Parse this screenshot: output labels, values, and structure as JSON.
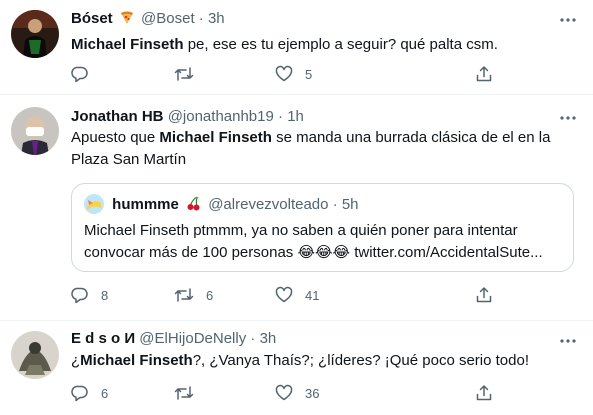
{
  "tweets": [
    {
      "name": "Bóset",
      "name_emoji_icon": "pizza-icon",
      "handle": "@Boset",
      "time": "3h",
      "text_highlight": "Michael Finseth",
      "text_rest": " pe, ese es tu ejemplo a seguir? qué palta csm.",
      "replies": "",
      "retweets": "",
      "likes": "5"
    },
    {
      "name": "Jonathan HB",
      "handle": "@jonathanhb19",
      "time": "1h",
      "text_pre": "Apuesto que ",
      "text_highlight": "Michael Finseth",
      "text_rest": " se manda una burrada clásica de el en la Plaza San Martín",
      "quote": {
        "name": "hummme",
        "name_emoji_icon": "cherries-icon",
        "handle": "@alrevezvolteado",
        "time": "5h",
        "text": "Michael Finseth ptmmm, ya no saben a quién poner para intentar convocar más de 100 personas 😂😂😂 twitter.com/AccidentalSute..."
      },
      "replies": "8",
      "retweets": "6",
      "likes": "41"
    },
    {
      "name": "E d s o И",
      "handle": "@ElHijoDeNelly",
      "time": "3h",
      "text_pre": "¿",
      "text_highlight": "Michael Finseth",
      "text_rest": "?, ¿Vanya Thaís?; ¿líderes? ¡Qué poco serio todo!",
      "replies": "6",
      "retweets": "",
      "likes": "36"
    }
  ],
  "separator": "·",
  "colors": {
    "text": "#0f1419",
    "secondary": "#536471",
    "border": "#eff3f4",
    "quote_border": "#cfd9de"
  }
}
